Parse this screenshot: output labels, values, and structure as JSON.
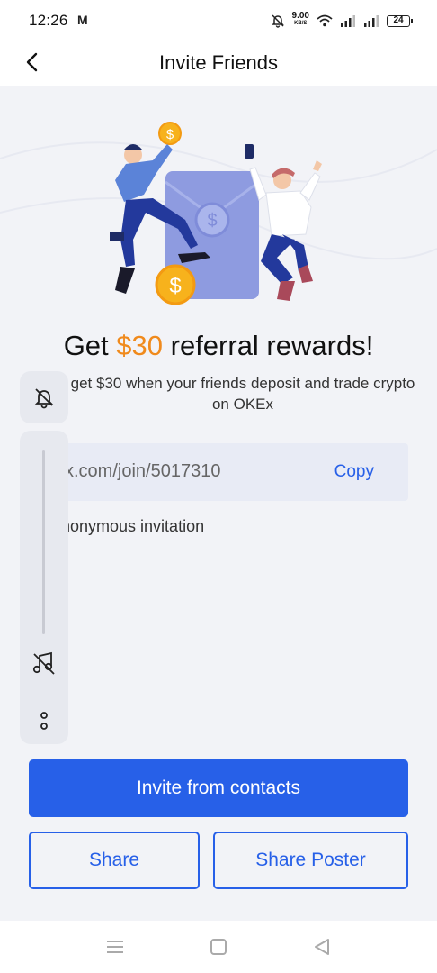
{
  "status": {
    "time": "12:26",
    "mail_icon": "M",
    "speed_value": "9.00",
    "speed_unit": "KB/S",
    "battery": "24"
  },
  "header": {
    "title": "Invite Friends"
  },
  "hero": {
    "headline_prefix": "Get ",
    "headline_amount": "$30",
    "headline_suffix": " referral rewards!",
    "subtitle": "get $30 when your friends deposit and trade crypto on OKEx"
  },
  "invite": {
    "link": "x.com/join/5017310",
    "copy_label": "Copy",
    "anonymous_label": "nonymous invitation"
  },
  "actions": {
    "invite_contacts": "Invite from contacts",
    "share": "Share",
    "share_poster": "Share Poster"
  },
  "icons": {
    "back": "chevron-left-icon",
    "bell": "bell-off-icon",
    "music": "music-off-icon",
    "more": "more-vertical-icon",
    "nav_menu": "menu-icon",
    "nav_home": "square-icon",
    "nav_back": "triangle-back-icon"
  },
  "colors": {
    "accent": "#2760e8",
    "amount": "#f08a1c",
    "background": "#f2f3f7"
  }
}
